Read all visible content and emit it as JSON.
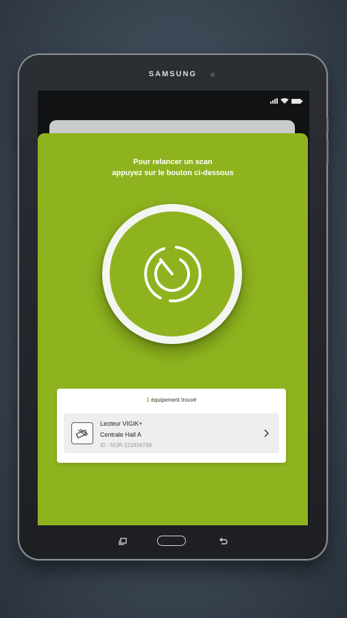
{
  "device": {
    "brand": "SAMSUNG"
  },
  "colors": {
    "accent_green": "#8fb31f",
    "scan_ring": "#f3f5f0",
    "background": "#3b4653"
  },
  "scan": {
    "instruction_line1": "Pour relancer un scan",
    "instruction_line2": "appuyez sur le bouton ci-dessous",
    "button_icon": "radar-scan-icon"
  },
  "results": {
    "count": "1",
    "title_suffix": " équipement trouvé",
    "devices": [
      {
        "icon": "reader-device-icon",
        "name": "Lecteur VIGIK+",
        "location": "Centrale Hall A",
        "id": "ID : NOR-123456789"
      }
    ]
  },
  "navigation": {
    "recent_icon": "recent-apps-icon",
    "home_icon": "home-button",
    "back_icon": "back-icon"
  }
}
